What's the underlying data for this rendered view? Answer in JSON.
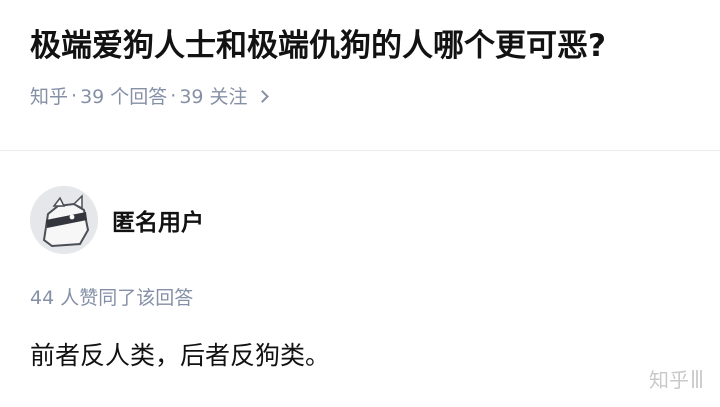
{
  "question": {
    "title": "极端爱狗人士和极端仇狗的人哪个更可恶?",
    "meta": {
      "source": "知乎",
      "answer_count": "39 个回答",
      "follow_count": "39 关注"
    }
  },
  "answer": {
    "author_name": "匿名用户",
    "avatar_icon": "anonymous-dog-mask-avatar",
    "votes_text": "44 人赞同了该回答",
    "content": "前者反人类，后者反狗类。"
  },
  "watermark": {
    "text": "知乎"
  },
  "colors": {
    "title": "#121212",
    "meta": "#8590a6",
    "divider": "#ebebeb",
    "avatar_bg": "#e6e7ea"
  }
}
